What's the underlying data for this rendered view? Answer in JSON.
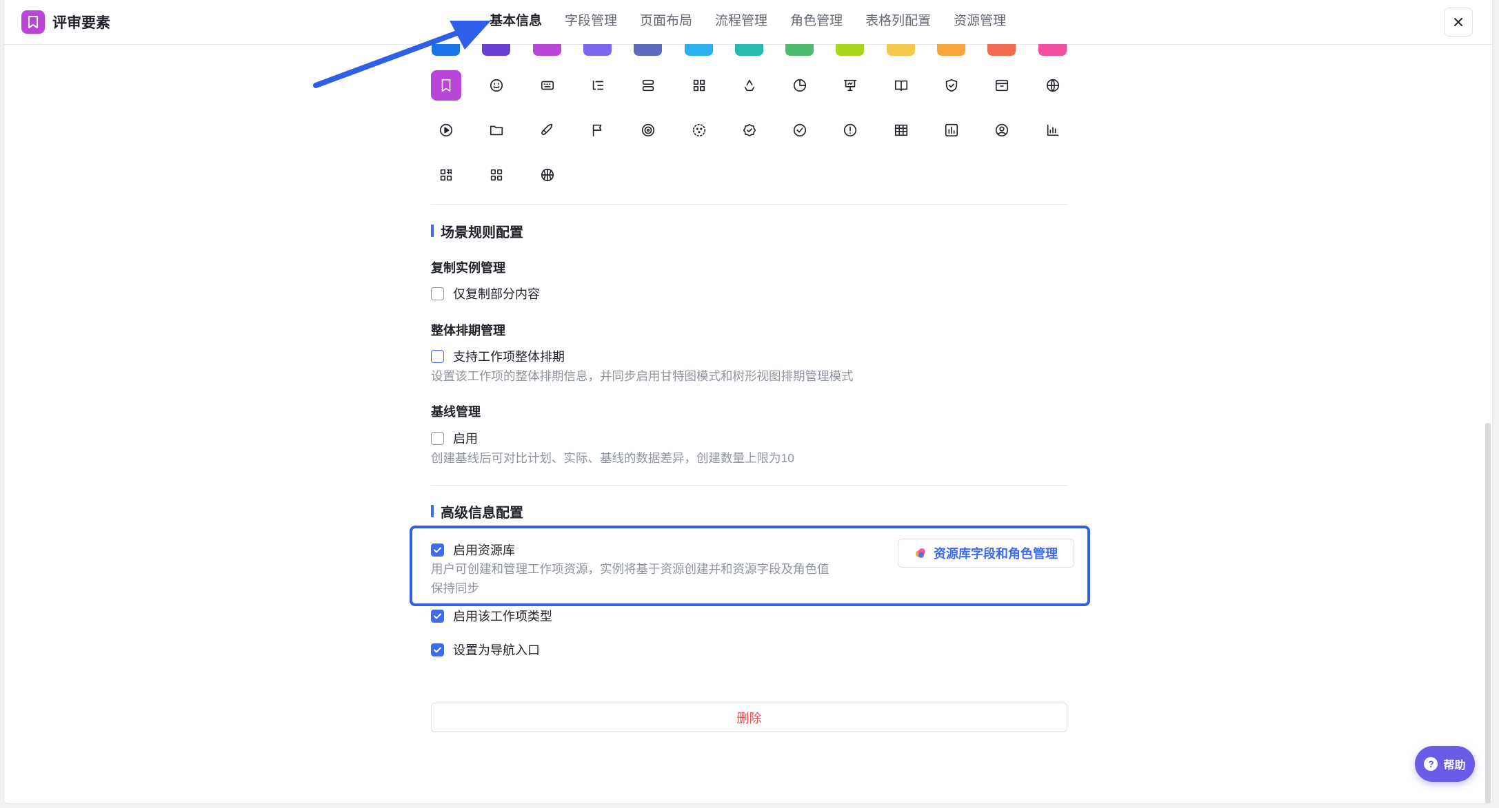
{
  "header": {
    "app_icon": "bookmark-icon",
    "title": "评审要素",
    "tabs": [
      {
        "label": "基本信息",
        "active": true
      },
      {
        "label": "字段管理",
        "active": false
      },
      {
        "label": "页面布局",
        "active": false
      },
      {
        "label": "流程管理",
        "active": false
      },
      {
        "label": "角色管理",
        "active": false
      },
      {
        "label": "表格列配置",
        "active": false
      },
      {
        "label": "资源管理",
        "active": false
      }
    ],
    "close_icon": "close-icon"
  },
  "color_swatches": [
    "#1a73e8",
    "#6a3fd6",
    "#b946d6",
    "#7b68ee",
    "#5c6bc0",
    "#2ab0ef",
    "#26bab0",
    "#4cbb6f",
    "#a8d61f",
    "#f3c84b",
    "#f7a53b",
    "#f26b4f",
    "#f04f9e"
  ],
  "accent_color": "#3c6bf2",
  "icons": [
    {
      "name": "bookmark-icon",
      "selected": true
    },
    {
      "name": "smile-icon"
    },
    {
      "name": "keyboard-icon"
    },
    {
      "name": "outline-list-icon"
    },
    {
      "name": "stack-icon"
    },
    {
      "name": "grid-icon"
    },
    {
      "name": "recycle-icon"
    },
    {
      "name": "pie-chart-icon"
    },
    {
      "name": "presentation-icon"
    },
    {
      "name": "book-icon"
    },
    {
      "name": "shield-check-icon"
    },
    {
      "name": "archive-icon"
    },
    {
      "name": "globe-icon"
    },
    {
      "name": "play-circle-icon"
    },
    {
      "name": "folder-icon"
    },
    {
      "name": "rocket-icon"
    },
    {
      "name": "flag-icon"
    },
    {
      "name": "target-icon"
    },
    {
      "name": "dotted-circle-icon"
    },
    {
      "name": "badge-check-icon"
    },
    {
      "name": "check-circle-icon"
    },
    {
      "name": "alert-circle-icon"
    },
    {
      "name": "table-icon"
    },
    {
      "name": "bar-box-icon"
    },
    {
      "name": "user-circle-icon"
    },
    {
      "name": "bar-chart-icon"
    },
    {
      "name": "qr-grid-icon"
    },
    {
      "name": "apps-icon"
    },
    {
      "name": "basketball-icon"
    }
  ],
  "scene_rules": {
    "title": "场景规则配置",
    "copy_instance": {
      "label": "复制实例管理",
      "option": "仅复制部分内容",
      "checked": false
    },
    "schedule": {
      "label": "整体排期管理",
      "option": "支持工作项整体排期",
      "checked": false,
      "description": "设置该工作项的整体排期信息，并同步启用甘特图模式和树形视图排期管理模式"
    },
    "baseline": {
      "label": "基线管理",
      "option": "启用",
      "checked": false,
      "description": "创建基线后可对比计划、实际、基线的数据差异，创建数量上限为10"
    }
  },
  "advanced": {
    "title": "高级信息配置",
    "resource_lib": {
      "option": "启用资源库",
      "checked": true,
      "description_line1": "用户可创建和管理工作项资源，实例将基于资源创建并和资源字段及角色值",
      "description_line2": "保持同步",
      "button_label": "资源库字段和角色管理"
    },
    "enable_type": {
      "option": "启用该工作项类型",
      "checked": true
    },
    "nav_entry": {
      "option": "设置为导航入口",
      "checked": true
    }
  },
  "delete_button": "删除",
  "help_button": "帮助"
}
